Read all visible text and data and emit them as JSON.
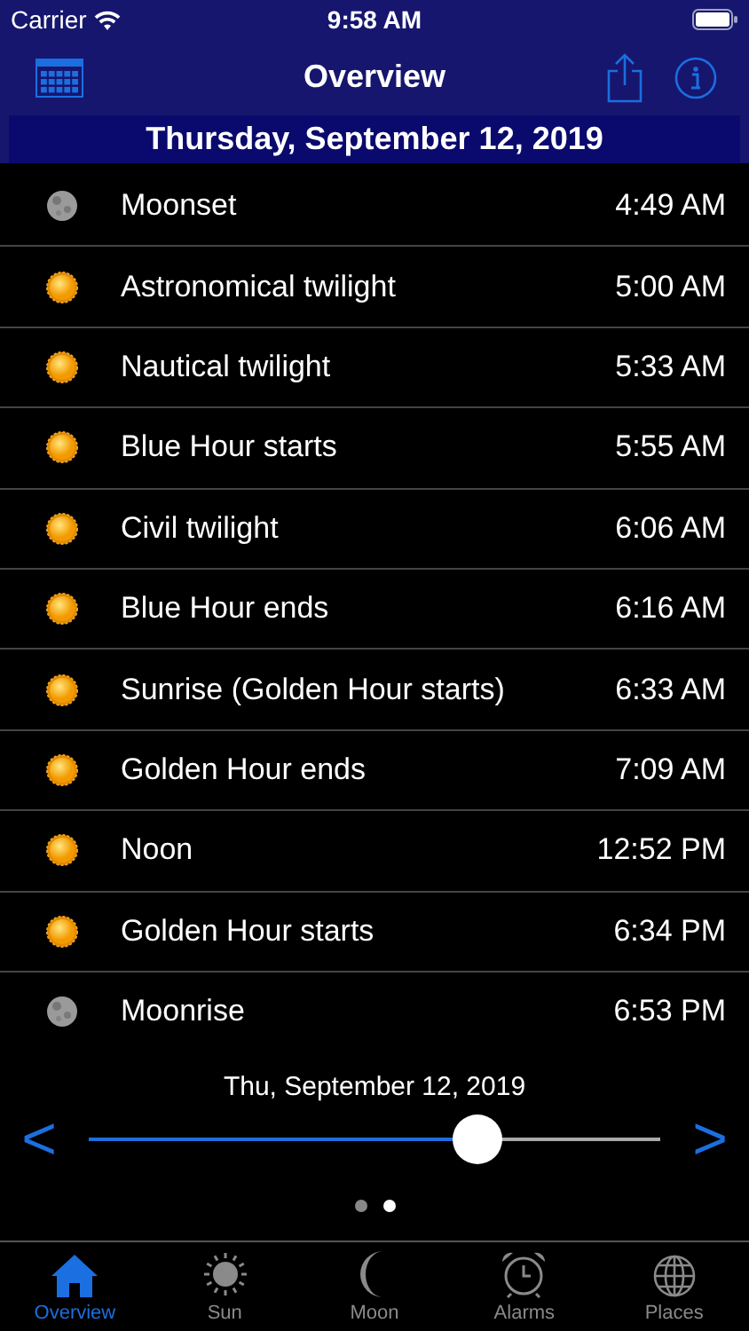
{
  "status_bar": {
    "carrier": "Carrier",
    "time": "9:58 AM"
  },
  "nav": {
    "title": "Overview"
  },
  "date_header": "Thursday, September 12, 2019",
  "events": [
    {
      "kind": "moon",
      "name": "Moonset",
      "time": "4:49 AM"
    },
    {
      "kind": "sun",
      "name": "Astronomical twilight",
      "time": "5:00 AM"
    },
    {
      "kind": "sun",
      "name": "Nautical twilight",
      "time": "5:33 AM"
    },
    {
      "kind": "sun",
      "name": "Blue Hour starts",
      "time": "5:55 AM"
    },
    {
      "kind": "sun",
      "name": "Civil twilight",
      "time": "6:06 AM"
    },
    {
      "kind": "sun",
      "name": "Blue Hour ends",
      "time": "6:16 AM"
    },
    {
      "kind": "sun",
      "name": "Sunrise (Golden Hour starts)",
      "time": "6:33 AM"
    },
    {
      "kind": "sun",
      "name": "Golden Hour ends",
      "time": "7:09 AM"
    },
    {
      "kind": "sun",
      "name": "Noon",
      "time": "12:52 PM"
    },
    {
      "kind": "sun",
      "name": "Golden Hour starts",
      "time": "6:34 PM"
    },
    {
      "kind": "moon",
      "name": "Moonrise",
      "time": "6:53 PM"
    }
  ],
  "date_slider": {
    "label": "Thu, September 12, 2019",
    "prev": "<",
    "next": ">",
    "level": 0.68
  },
  "page_dots": [
    {
      "selected": false
    },
    {
      "selected": true
    }
  ],
  "tabs": [
    {
      "kind": "home",
      "label": "Overview",
      "selected": true
    },
    {
      "kind": "sun",
      "label": "Sun",
      "selected": false
    },
    {
      "kind": "moon",
      "label": "Moon",
      "selected": false
    },
    {
      "kind": "alarm",
      "label": "Alarms",
      "selected": false
    },
    {
      "kind": "globe",
      "label": "Places",
      "selected": false
    }
  ]
}
